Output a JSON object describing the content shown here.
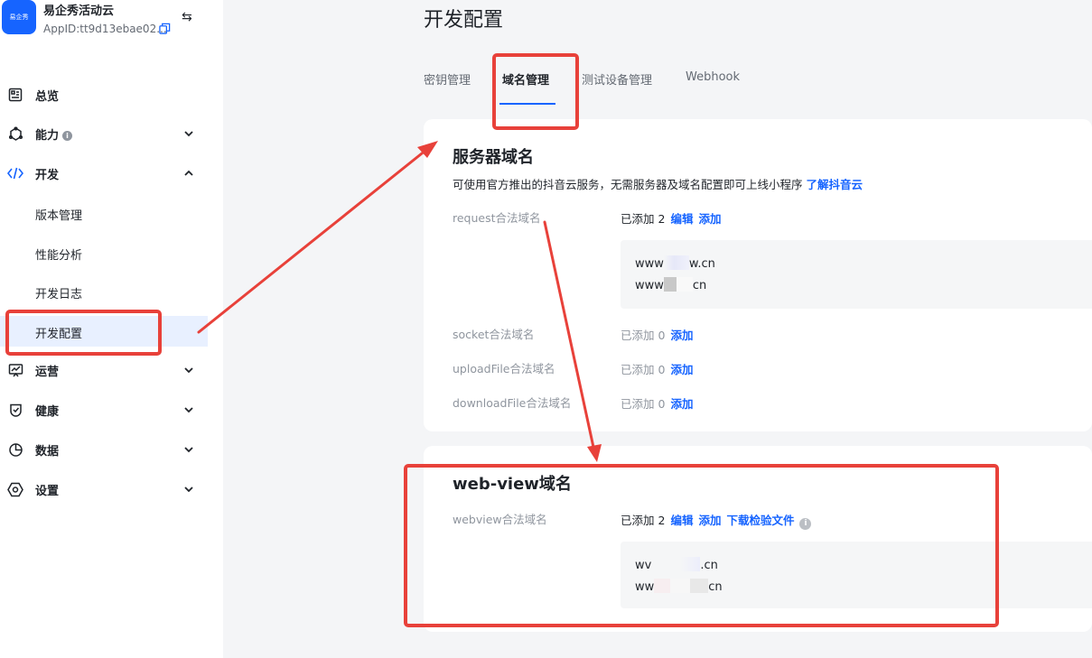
{
  "app": {
    "logo_text": "易企秀",
    "name": "易企秀活动云",
    "app_id": "AppID:tt9d13ebae02..."
  },
  "sidebar": {
    "items": [
      {
        "label": "总览",
        "icon": "dashboard-icon"
      },
      {
        "label": "能力",
        "icon": "capability-icon",
        "has_info": true,
        "info": "i"
      },
      {
        "label": "开发",
        "icon": "code-icon",
        "expanded": true
      },
      {
        "label": "运营",
        "icon": "operation-icon"
      },
      {
        "label": "健康",
        "icon": "health-icon"
      },
      {
        "label": "数据",
        "icon": "data-icon"
      },
      {
        "label": "设置",
        "icon": "settings-icon"
      }
    ],
    "dev_subitems": [
      {
        "label": "版本管理"
      },
      {
        "label": "性能分析"
      },
      {
        "label": "开发日志"
      },
      {
        "label": "开发配置",
        "selected": true
      }
    ]
  },
  "page": {
    "title": "开发配置",
    "tabs": [
      {
        "label": "密钥管理"
      },
      {
        "label": "域名管理",
        "active": true
      },
      {
        "label": "测试设备管理"
      },
      {
        "label": "Webhook"
      }
    ]
  },
  "server_domain": {
    "title": "服务器域名",
    "desc": "可使用官方推出的抖音云服务，无需服务器及域名配置即可上线小程序",
    "desc_link": "了解抖音云",
    "rows": [
      {
        "label": "request合法域名",
        "count": "已添加 2",
        "actions": [
          "编辑",
          "添加"
        ],
        "domains": [
          [
            "www",
            "w.cn"
          ],
          [
            "www",
            "cn"
          ]
        ]
      },
      {
        "label": "socket合法域名",
        "count": "已添加 0",
        "actions": [
          "添加"
        ]
      },
      {
        "label": "uploadFile合法域名",
        "count": "已添加 0",
        "actions": [
          "添加"
        ]
      },
      {
        "label": "downloadFile合法域名",
        "count": "已添加 0",
        "actions": [
          "添加"
        ]
      }
    ]
  },
  "webview_domain": {
    "title": "web-view域名",
    "row": {
      "label": "webview合法域名",
      "count": "已添加 2",
      "actions": [
        "编辑",
        "添加",
        "下载检验文件"
      ],
      "info": "i",
      "domains": [
        [
          "wv",
          ".cn"
        ],
        [
          "ww",
          "cn"
        ]
      ]
    }
  },
  "colors": {
    "accent": "#1664ff",
    "annotation": "#e8413a",
    "selected_bg": "#e8f0ff"
  }
}
